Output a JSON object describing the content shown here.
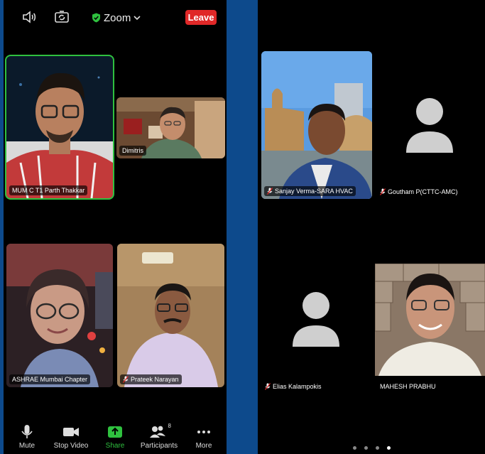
{
  "app": {
    "title": "Zoom",
    "leave_label": "Leave",
    "colors": {
      "leave": "#e02828",
      "active_speaker": "#2fc13f",
      "share": "#2fc13f",
      "background": "#0d4a8c"
    }
  },
  "left_grid": {
    "tiles": [
      {
        "name": "MUM C T1 Parth Thakkar",
        "muted": false,
        "active": true
      },
      {
        "name": "Dimitris",
        "muted": false,
        "active": false
      },
      {
        "name": "ASHRAE Mumbai Chapter",
        "muted": false,
        "active": false
      },
      {
        "name": "Prateek Narayan",
        "muted": true,
        "active": false
      }
    ]
  },
  "toolbar": {
    "mute": "Mute",
    "stop_video": "Stop Video",
    "share": "Share",
    "participants": "Participants",
    "participants_count": "8",
    "more": "More"
  },
  "right_grid": {
    "tiles": [
      {
        "name": "Sanjay Verma-SARA HVAC",
        "muted": true
      },
      {
        "name": "Goutham P(CTTC-AMC)",
        "muted": true,
        "video": false
      },
      {
        "name": "Elias Kalampokis",
        "muted": true,
        "video": false
      },
      {
        "name": "MAHESH PRABHU",
        "muted": false
      }
    ],
    "pages": 4,
    "current_page": 4
  }
}
